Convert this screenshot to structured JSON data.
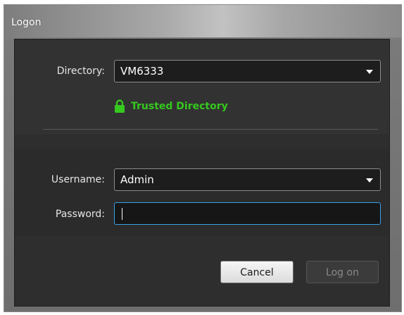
{
  "window": {
    "title": "Logon"
  },
  "directory": {
    "label": "Directory:",
    "value": "VM6333",
    "status_text": "Trusted Directory",
    "status_color": "#35c81e",
    "status_icon": "lock-icon"
  },
  "username": {
    "label": "Username:",
    "value": "Admin"
  },
  "password": {
    "label": "Password:",
    "value": ""
  },
  "buttons": {
    "cancel_label": "Cancel",
    "logon_label": "Log on"
  },
  "colors": {
    "focus_border": "#3aa0e8"
  }
}
